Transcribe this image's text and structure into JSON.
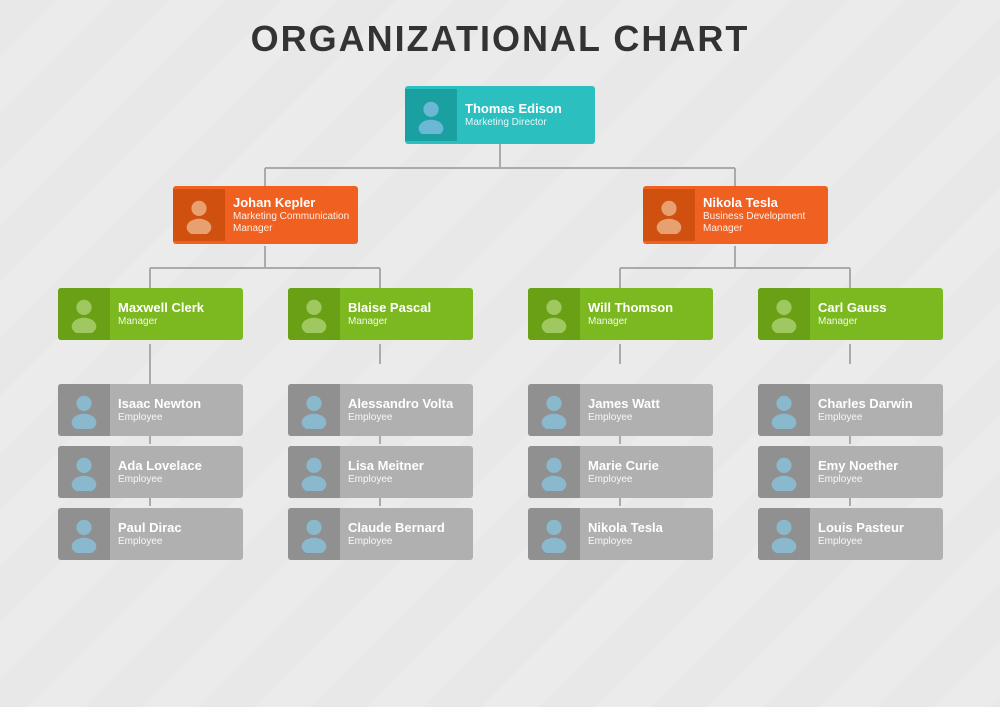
{
  "title": "ORGANIZATIONAL CHART",
  "nodes": {
    "top": {
      "name": "Thomas Edison",
      "role": "Marketing Director",
      "color": "teal"
    },
    "lvl1_left": {
      "name": "Johan Kepler",
      "role": "Marketing Communication Manager",
      "color": "orange"
    },
    "lvl1_right": {
      "name": "Nikola Tesla",
      "role": "Business Development Manager",
      "color": "orange"
    },
    "lvl2_1": {
      "name": "Maxwell Clerk",
      "role": "Manager",
      "color": "green"
    },
    "lvl2_2": {
      "name": "Blaise Pascal",
      "role": "Manager",
      "color": "green"
    },
    "lvl2_3": {
      "name": "Will Thomson",
      "role": "Manager",
      "color": "green"
    },
    "lvl2_4": {
      "name": "Carl Gauss",
      "role": "Manager",
      "color": "green"
    },
    "emp_1_1": {
      "name": "Isaac Newton",
      "role": "Employee",
      "color": "gray"
    },
    "emp_1_2": {
      "name": "Ada Lovelace",
      "role": "Employee",
      "color": "gray"
    },
    "emp_1_3": {
      "name": "Paul Dirac",
      "role": "Employee",
      "color": "gray"
    },
    "emp_2_1": {
      "name": "Alessandro Volta",
      "role": "Employee",
      "color": "gray"
    },
    "emp_2_2": {
      "name": "Lisa Meitner",
      "role": "Employee",
      "color": "gray"
    },
    "emp_2_3": {
      "name": "Claude Bernard",
      "role": "Employee",
      "color": "gray"
    },
    "emp_3_1": {
      "name": "James Watt",
      "role": "Employee",
      "color": "gray"
    },
    "emp_3_2": {
      "name": "Marie Curie",
      "role": "Employee",
      "color": "gray"
    },
    "emp_3_3": {
      "name": "Nikola Tesla",
      "role": "Employee",
      "color": "gray"
    },
    "emp_4_1": {
      "name": "Charles Darwin",
      "role": "Employee",
      "color": "gray"
    },
    "emp_4_2": {
      "name": "Emy Noether",
      "role": "Employee",
      "color": "gray"
    },
    "emp_4_3": {
      "name": "Louis Pasteur",
      "role": "Employee",
      "color": "gray"
    }
  }
}
